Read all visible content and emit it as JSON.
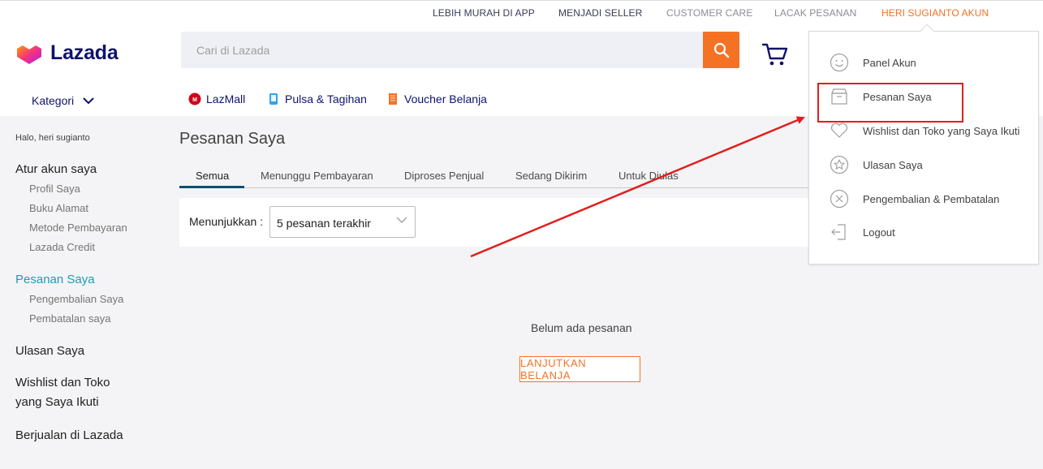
{
  "topbar": {
    "links": [
      {
        "label": "LEBIH MURAH DI APP"
      },
      {
        "label": "MENJADI SELLER"
      },
      {
        "label": "CUSTOMER CARE"
      },
      {
        "label": "LACAK PESANAN"
      },
      {
        "label": "HERI SUGIANTO AKUN"
      }
    ]
  },
  "brand": {
    "name": "Lazada"
  },
  "search": {
    "placeholder": "Cari di Lazada"
  },
  "nav": {
    "category_label": "Kategori",
    "quick_links": [
      {
        "label": "LazMall"
      },
      {
        "label": "Pulsa & Tagihan"
      },
      {
        "label": "Voucher Belanja"
      }
    ]
  },
  "sidebar": {
    "greeting": "Halo, heri sugianto",
    "account_heading": "Atur akun saya",
    "account_items": [
      "Profil Saya",
      "Buku Alamat",
      "Metode Pembayaran",
      "Lazada Credit"
    ],
    "orders_heading": "Pesanan Saya",
    "orders_items": [
      "Pengembalian Saya",
      "Pembatalan saya"
    ],
    "reviews": "Ulasan Saya",
    "wishlist_line1": "Wishlist dan Toko",
    "wishlist_line2": "yang Saya Ikuti",
    "sell": "Berjualan di Lazada"
  },
  "main": {
    "title": "Pesanan Saya",
    "tabs": [
      "Semua",
      "Menunggu Pembayaran",
      "Diproses Penjual",
      "Sedang Dikirim",
      "Untuk Diulas"
    ],
    "filter_label": "Menunjukkan :",
    "filter_value": "5 pesanan terakhir",
    "empty_text": "Belum ada pesanan",
    "continue_label": "LANJUTKAN BELANJA"
  },
  "account_menu": {
    "items": [
      {
        "label": "Panel Akun",
        "icon": "smiley-icon"
      },
      {
        "label": "Pesanan Saya",
        "icon": "box-icon"
      },
      {
        "label": "Wishlist dan Toko yang Saya Ikuti",
        "icon": "heart-icon"
      },
      {
        "label": "Ulasan Saya",
        "icon": "star-icon"
      },
      {
        "label": "Pengembalian & Pembatalan",
        "icon": "cancel-icon"
      },
      {
        "label": "Logout",
        "icon": "logout-icon"
      }
    ]
  },
  "colors": {
    "brand_navy": "#0f136d",
    "accent_orange": "#f57224",
    "active_teal": "#1a9cb7",
    "annotation_red": "#e01e1e"
  }
}
